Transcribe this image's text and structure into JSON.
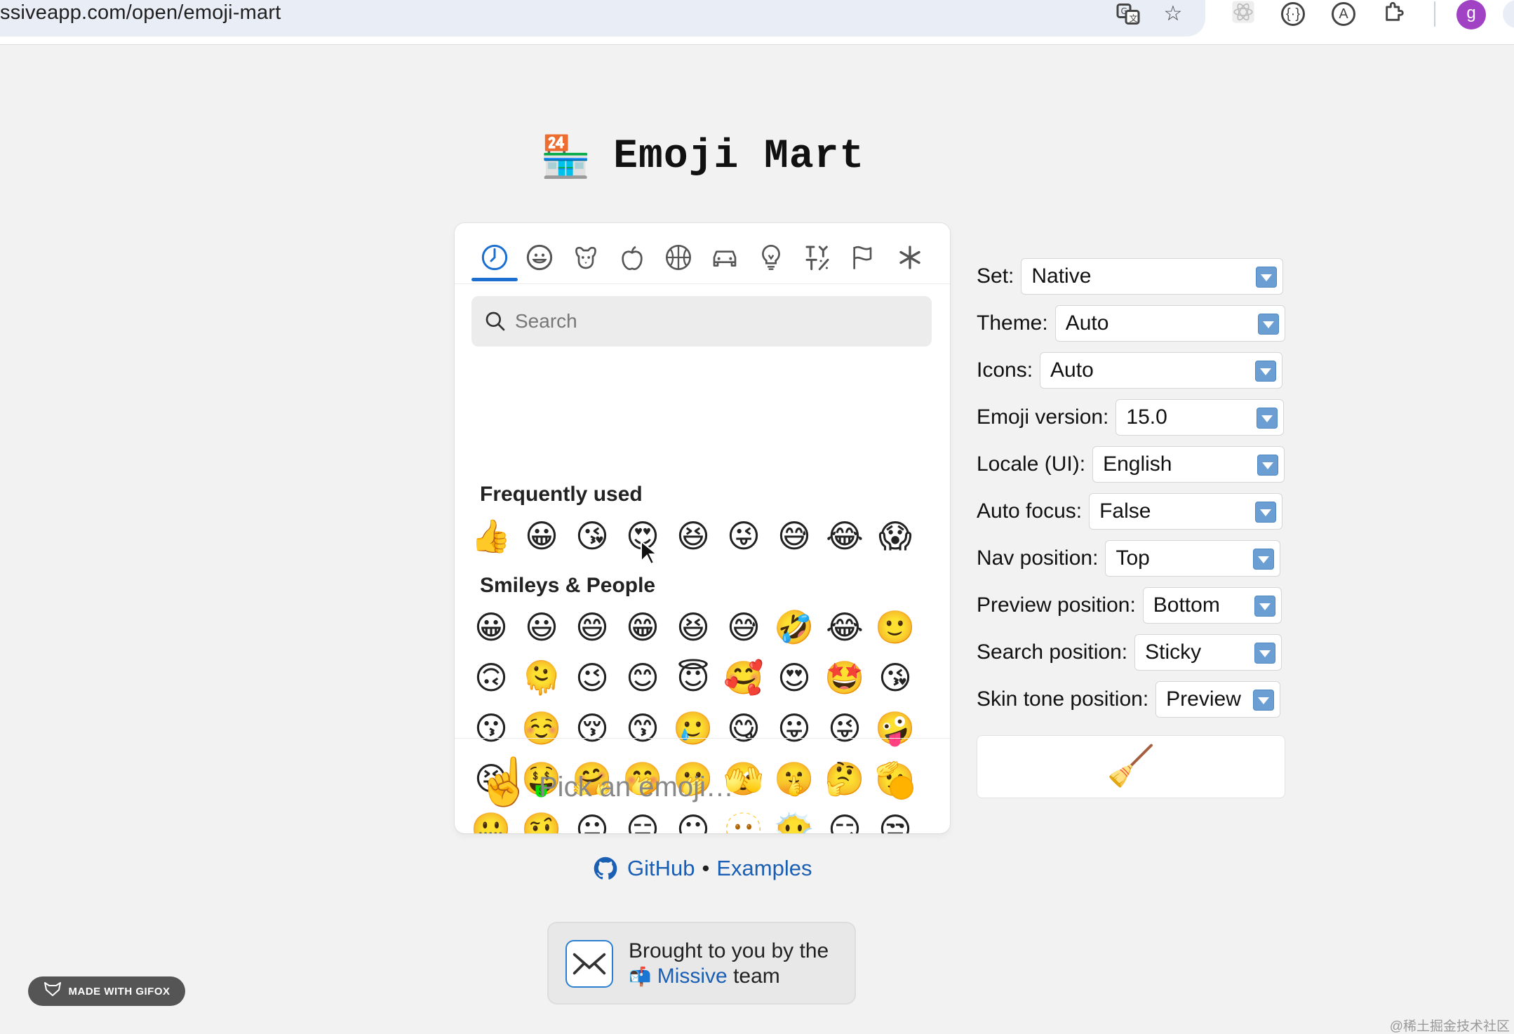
{
  "browser": {
    "url": "ssiveapp.com/open/emoji-mart",
    "avatar_letter": "g"
  },
  "page": {
    "title": "Emoji Mart",
    "title_emoji": "🏪"
  },
  "picker": {
    "nav_icons": [
      "clock-icon",
      "smiley-icon",
      "dog-icon",
      "apple-icon",
      "basketball-icon",
      "car-icon",
      "lightbulb-icon",
      "symbols-icon",
      "flags-icon",
      "asterisk-icon"
    ],
    "search_placeholder": "Search",
    "sections": [
      {
        "title": "Frequently used",
        "emojis": [
          "👍",
          "😀",
          "😘",
          "😍",
          "😆",
          "😜",
          "😅",
          "😂",
          "😱"
        ]
      },
      {
        "title": "Smileys & People",
        "emojis": [
          "😀",
          "😃",
          "😄",
          "😁",
          "😆",
          "😅",
          "🤣",
          "😂",
          "🙂",
          "🙃",
          "🫠",
          "😉",
          "😊",
          "😇",
          "🥰",
          "😍",
          "🤩",
          "😘",
          "😗",
          "☺️",
          "😚",
          "😙",
          "🥲",
          "😋",
          "😛",
          "😜",
          "🤪",
          "😝",
          "🤑",
          "🤗",
          "🤭",
          "🫢",
          "🫣",
          "🤫",
          "🤔",
          "🫡",
          "🤐",
          "🤨",
          "😐",
          "😑",
          "😶",
          "🫥",
          "😶‍🌫️",
          "😏",
          "😒"
        ]
      }
    ],
    "preview_emoji": "☝️",
    "preview_placeholder": "Pick an emoji…",
    "skin_tone_color": "#ffb300"
  },
  "settings": [
    {
      "label": "Set:",
      "value": "Native"
    },
    {
      "label": "Theme:",
      "value": "Auto"
    },
    {
      "label": "Icons:",
      "value": "Auto"
    },
    {
      "label": "Emoji version:",
      "value": "15.0"
    },
    {
      "label": "Locale (UI):",
      "value": "English"
    },
    {
      "label": "Auto focus:",
      "value": "False"
    },
    {
      "label": "Nav position:",
      "value": "Top"
    },
    {
      "label": "Preview position:",
      "value": "Bottom"
    },
    {
      "label": "Search position:",
      "value": "Sticky"
    },
    {
      "label": "Skin tone position:",
      "value": "Preview"
    }
  ],
  "reset_emoji": "🧹",
  "links": {
    "github": "GitHub",
    "separator": "•",
    "examples": "Examples"
  },
  "banner": {
    "line1": "Brought to you by the",
    "line2_emoji": "📬",
    "line2_link": "Missive",
    "line2_suffix": "team"
  },
  "gifox_label": "MADE WITH GIFOX",
  "watermark": "@稀土掘金技术社区",
  "colors": {
    "accent": "#1a6fd0",
    "link": "#1a5fb4",
    "page_bg": "#f2f2f2"
  }
}
